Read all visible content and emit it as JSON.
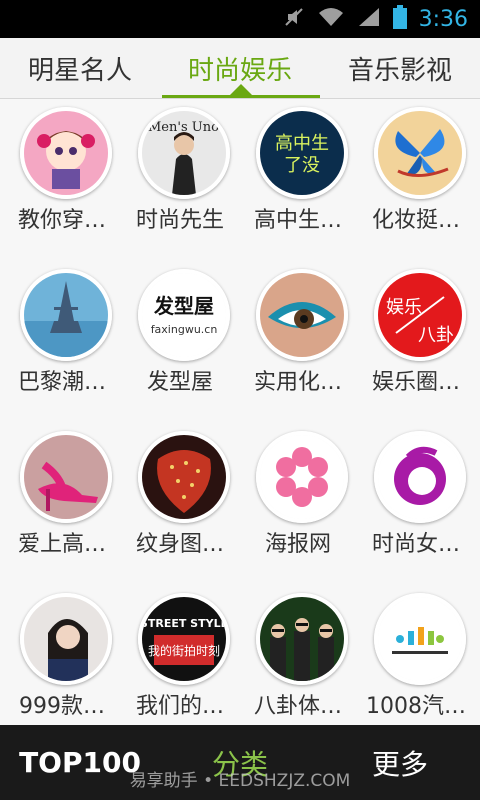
{
  "status": {
    "time": "3:36",
    "icons": [
      "mute-icon",
      "wifi-icon",
      "signal-icon",
      "battery-icon"
    ],
    "time_color": "#33b5e5"
  },
  "tabs": [
    {
      "label": "明星名人",
      "active": false
    },
    {
      "label": "时尚娱乐",
      "active": true
    },
    {
      "label": "音乐影视",
      "active": false
    }
  ],
  "accent_color": "#6aa812",
  "grid": [
    {
      "label": "教你穿…",
      "icon": "anime-girl-avatar"
    },
    {
      "label": "时尚先生",
      "icon": "fashion-magazine-avatar"
    },
    {
      "label": "高中生…",
      "icon": "highschool-text-avatar"
    },
    {
      "label": "化妆挺…",
      "icon": "butterfly-avatar"
    },
    {
      "label": "巴黎潮…",
      "icon": "eiffel-tower-avatar"
    },
    {
      "label": "发型屋",
      "icon": "faxingwu-logo-avatar"
    },
    {
      "label": "实用化…",
      "icon": "eye-makeup-avatar"
    },
    {
      "label": "娱乐圈…",
      "icon": "gossip-logo-avatar"
    },
    {
      "label": "爱上高…",
      "icon": "high-heels-avatar"
    },
    {
      "label": "纹身图…",
      "icon": "strawberry-avatar"
    },
    {
      "label": "海报网",
      "icon": "pink-flower-avatar"
    },
    {
      "label": "时尚女…",
      "icon": "purple-swirl-avatar"
    },
    {
      "label": "999款…",
      "icon": "girl-portrait-avatar"
    },
    {
      "label": "我们的…",
      "icon": "street-style-avatar"
    },
    {
      "label": "八卦体…",
      "icon": "psy-group-avatar"
    },
    {
      "label": "1008汽…",
      "icon": "radio-1008-logo-avatar"
    }
  ],
  "avatar_text": {
    "highschool": "高中生了没",
    "faxingwu": "发型屋",
    "faxingwu_url": "faxingwu.cn",
    "gossip": "娱乐八卦",
    "street_style": "STREET STYLE",
    "street_sub": "我的街拍时刻",
    "fashion_mag": "Men's Uno"
  },
  "bottom": {
    "top100": "TOP100",
    "category": "分类",
    "more": "更多"
  },
  "watermark": "易享助手 • EEDSHZJZ.COM"
}
